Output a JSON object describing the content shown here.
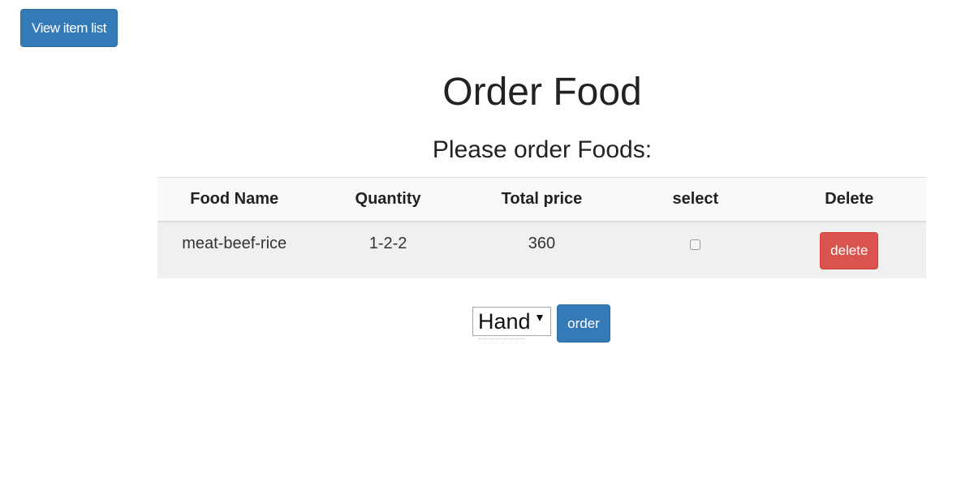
{
  "header": {
    "view_items_label": "View item list"
  },
  "page": {
    "title": "Order Food",
    "subtitle": "Please order Foods:"
  },
  "table": {
    "headers": [
      "Food Name",
      "Quantity",
      "Total price",
      "select",
      "Delete"
    ],
    "rows": [
      {
        "food_name": "meat-beef-rice",
        "quantity": "1-2-2",
        "total_price": "360",
        "selected": false,
        "delete_label": "delete"
      }
    ]
  },
  "order_form": {
    "delivery_select_value": "Hand",
    "order_label": "order"
  },
  "colors": {
    "primary": "#337ab7",
    "danger": "#d9534f",
    "header_row_bg": "#f9f9f9",
    "body_row_bg": "#f0f0f0"
  }
}
